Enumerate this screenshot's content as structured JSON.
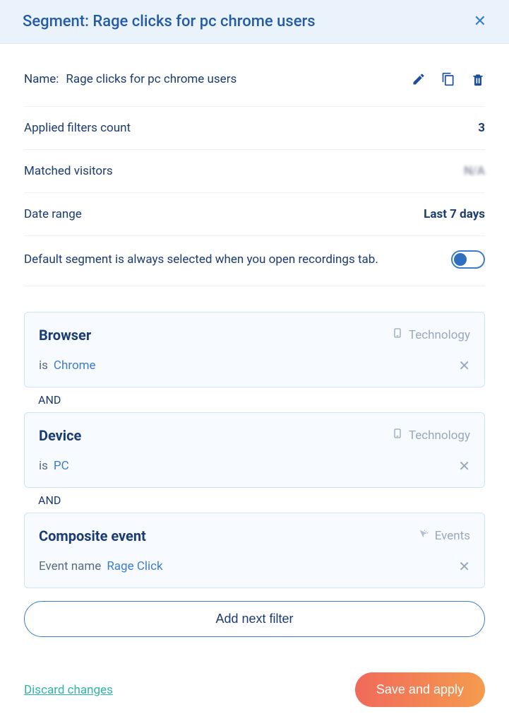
{
  "header": {
    "title": "Segment: Rage clicks for pc chrome users"
  },
  "name": {
    "label": "Name:",
    "value": "Rage clicks for pc chrome users"
  },
  "stats": {
    "applied_filters_label": "Applied filters count",
    "applied_filters_value": "3",
    "matched_visitors_label": "Matched visitors",
    "matched_visitors_value": "N/A",
    "date_range_label": "Date range",
    "date_range_value": "Last 7 days"
  },
  "default_segment": {
    "label": "Default segment is always selected when you open recordings tab.",
    "on": true
  },
  "filters": [
    {
      "title": "Browser",
      "category": "Technology",
      "category_icon": "device-icon",
      "operator": "is",
      "value": "Chrome"
    },
    {
      "title": "Device",
      "category": "Technology",
      "category_icon": "device-icon",
      "operator": "is",
      "value": "PC"
    },
    {
      "title": "Composite event",
      "category": "Events",
      "category_icon": "cursor-icon",
      "operator": "Event name",
      "value": "Rage Click"
    }
  ],
  "conjunction": "AND",
  "buttons": {
    "add_filter": "Add next filter",
    "discard": "Discard changes",
    "save": "Save and apply"
  }
}
